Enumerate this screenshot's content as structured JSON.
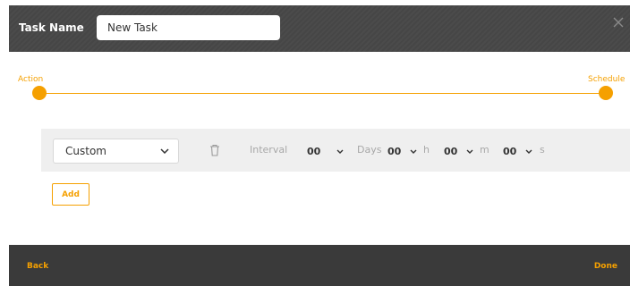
{
  "header": {
    "task_name_label": "Task Name",
    "task_name_value": "New Task",
    "close_icon": "close-icon"
  },
  "stepper": {
    "steps": [
      {
        "label": "Action"
      },
      {
        "label": "Schedule"
      }
    ]
  },
  "schedule_row": {
    "type_select": {
      "value": "Custom"
    },
    "interval_label": "Interval",
    "days": {
      "value": "00",
      "unit": "Days"
    },
    "hours": {
      "value": "00",
      "unit": "h"
    },
    "minutes": {
      "value": "00",
      "unit": "m"
    },
    "seconds": {
      "value": "00",
      "unit": "s"
    }
  },
  "add_button_label": "Add",
  "footer": {
    "back_label": "Back",
    "done_label": "Done"
  },
  "colors": {
    "accent": "#f5a000",
    "header_bg": "#4b4b4b",
    "footer_bg": "#3a3a3a",
    "row_bg": "#efefef"
  }
}
